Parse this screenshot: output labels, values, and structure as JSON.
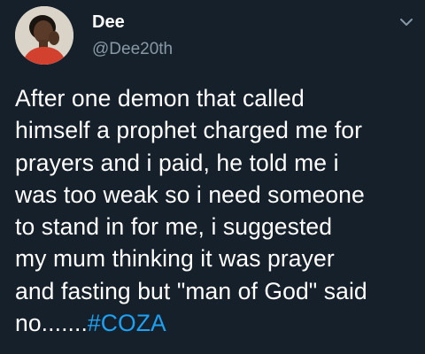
{
  "tweet": {
    "display_name": "Dee",
    "handle": "@Dee20th",
    "avatar_icon": "profile-photo",
    "menu_icon": "chevron-down-icon",
    "text_lines": [
      "After one demon that called",
      "himself a prophet charged me for",
      "prayers and i paid, he told me i",
      "was too weak so i need someone",
      "to stand in for me, i suggested",
      "my mum thinking it was prayer",
      "and fasting but \"man of God\" said"
    ],
    "last_line_prefix": "no.......",
    "hashtag": "#COZA"
  },
  "colors": {
    "background": "#15202b",
    "text": "#ffffff",
    "secondary_text": "#8899a6",
    "link": "#1da1f2"
  }
}
